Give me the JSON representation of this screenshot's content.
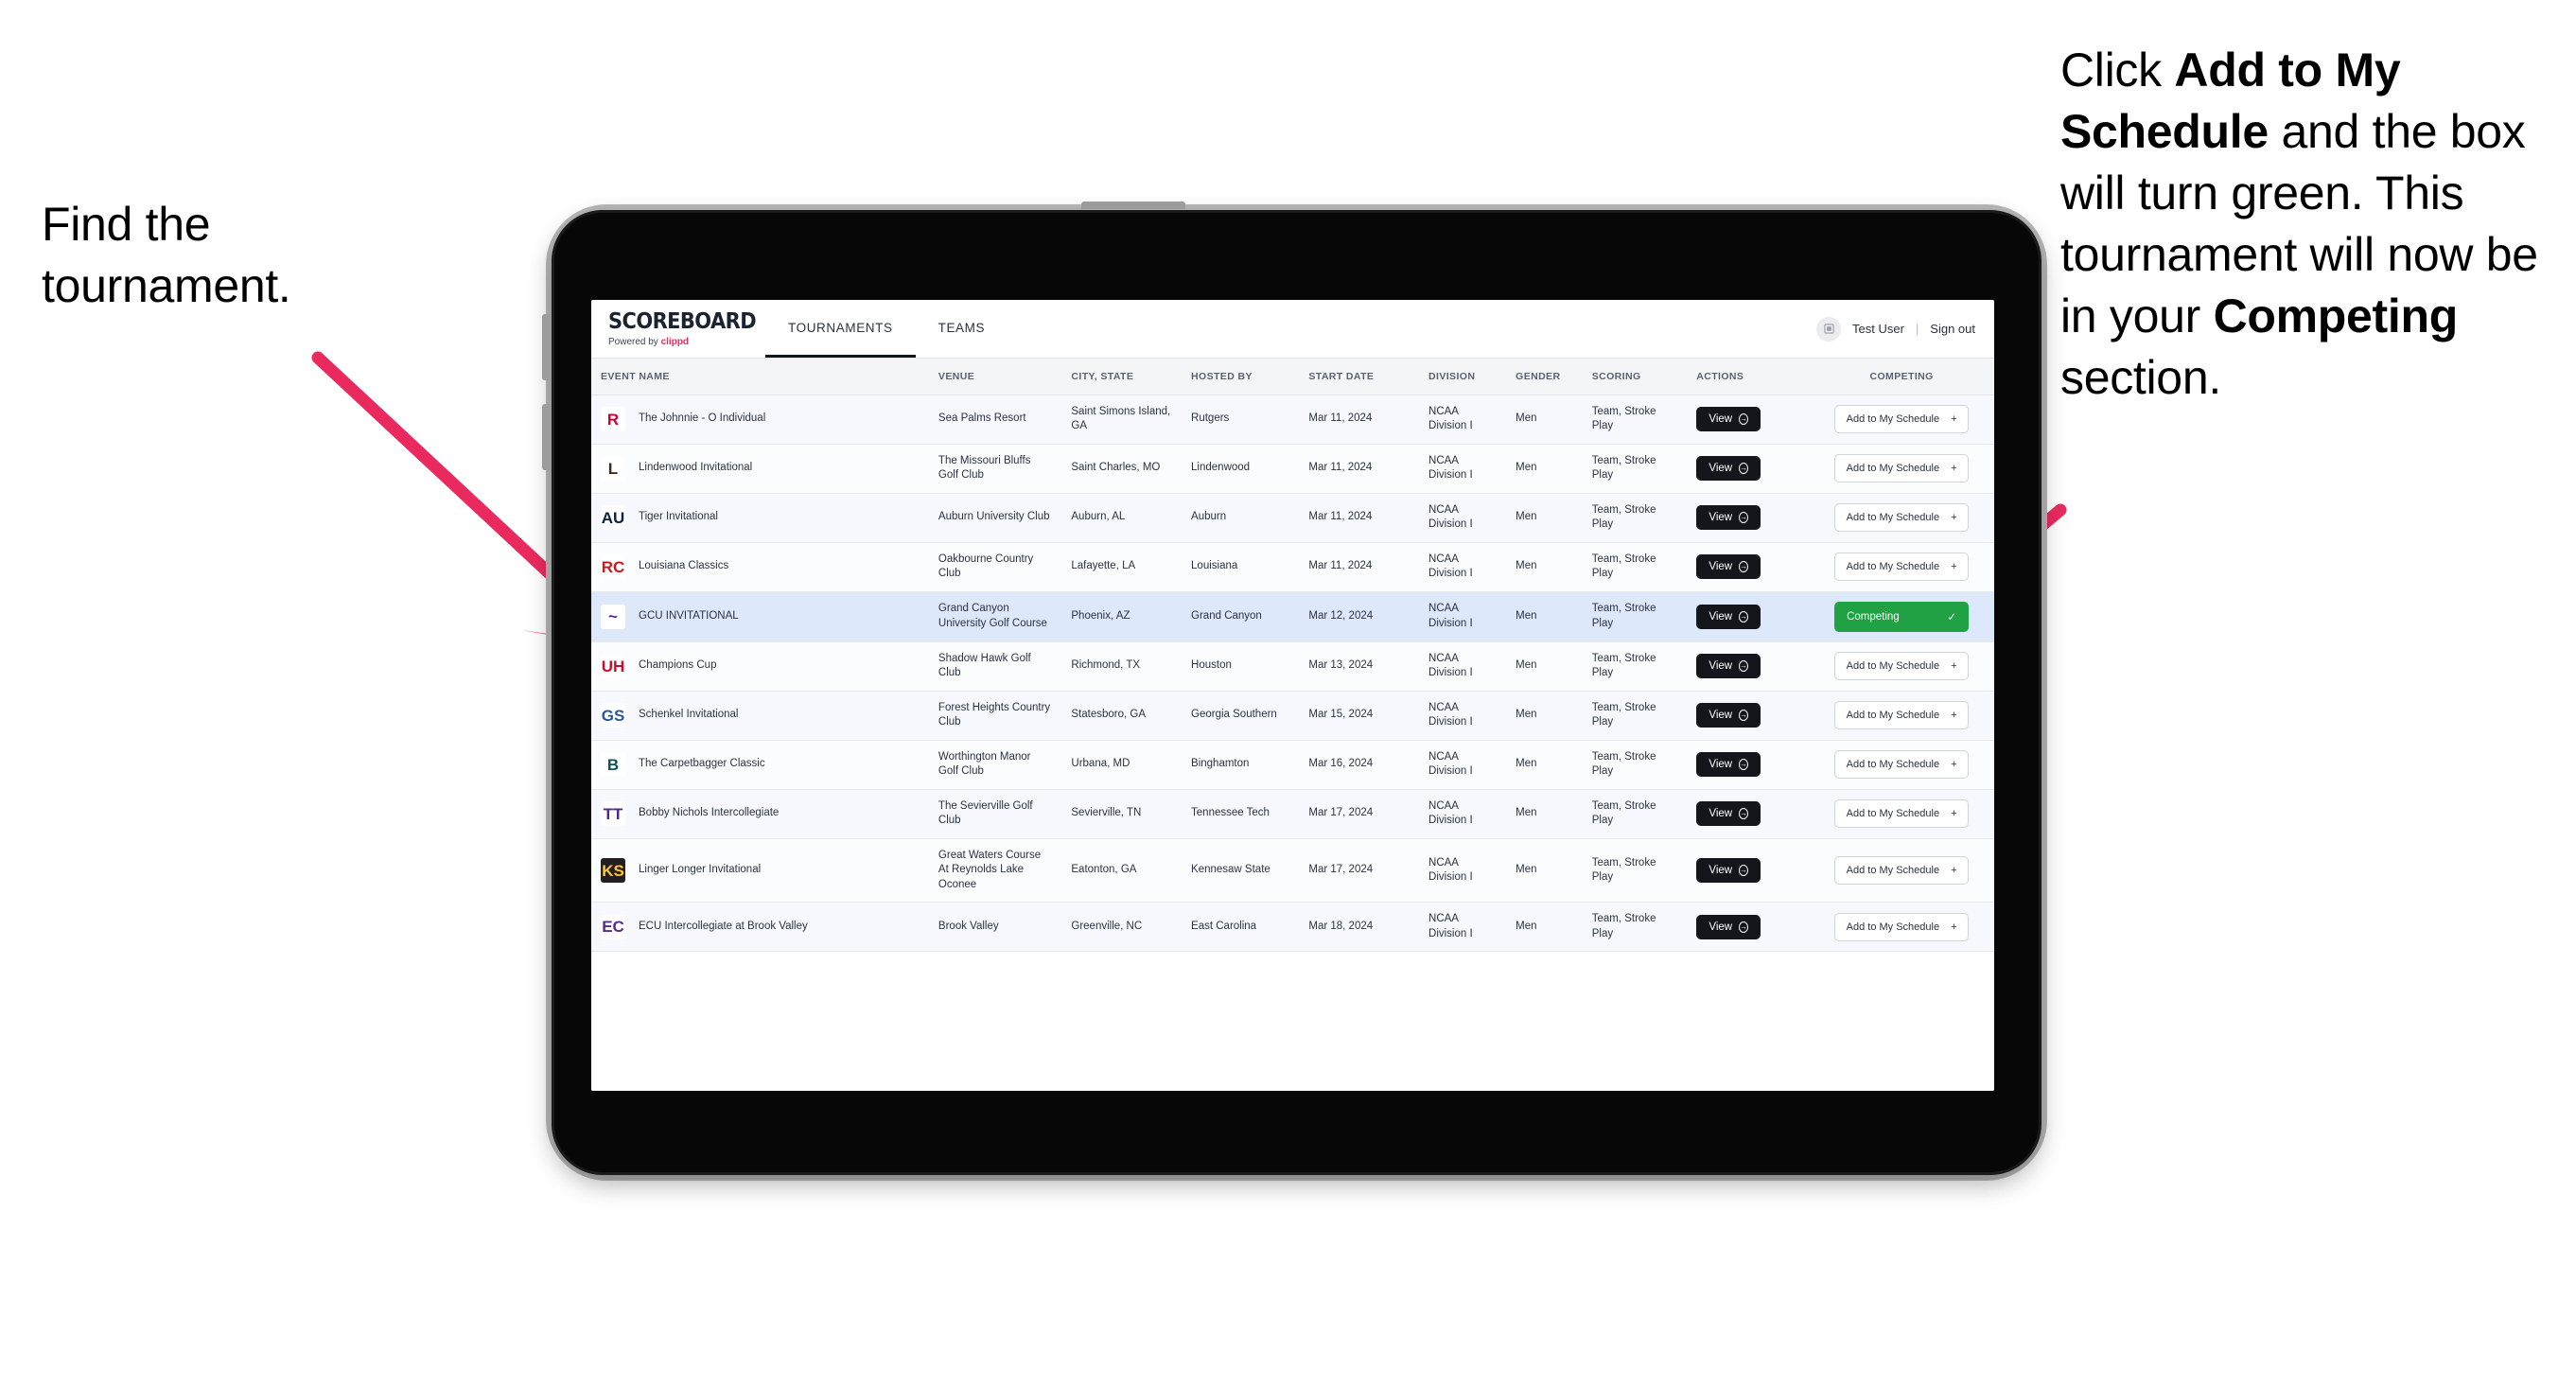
{
  "annotations": {
    "left": {
      "text": "Find the tournament."
    },
    "right": {
      "line1_pre": "Click ",
      "line1_bold": "Add to My Schedule",
      "line1_post": " and the box will turn green. This tournament will now be in your ",
      "line2_bold": "Competing",
      "line2_post": " section."
    },
    "arrow_color": "#ea2a5f"
  },
  "app": {
    "brand": {
      "title": "SCOREBOARD",
      "powered_prefix": "Powered by ",
      "powered_brand": "clippd"
    },
    "tabs": [
      {
        "label": "TOURNAMENTS",
        "active": true
      },
      {
        "label": "TEAMS",
        "active": false
      }
    ],
    "header_right": {
      "avatar_icon": "user-avatar-icon",
      "user_name": "Test User",
      "separator": "|",
      "sign_out": "Sign out"
    }
  },
  "table": {
    "columns": [
      "EVENT NAME",
      "VENUE",
      "CITY, STATE",
      "HOSTED BY",
      "START DATE",
      "DIVISION",
      "GENDER",
      "SCORING",
      "ACTIONS",
      "COMPETING"
    ],
    "view_label": "View",
    "add_label": "Add to My Schedule",
    "add_icon": "plus-icon",
    "competing_label": "Competing",
    "competing_icon": "check-icon",
    "rows": [
      {
        "logo_text": "R",
        "logo_color": "#cc0033",
        "logo_bg": "#ffffff",
        "event": "The Johnnie - O Individual",
        "venue": "Sea Palms Resort",
        "city": "Saint Simons Island, GA",
        "host": "Rutgers",
        "date": "Mar 11, 2024",
        "division": "NCAA Division I",
        "gender": "Men",
        "scoring": "Team, Stroke Play",
        "competing": false
      },
      {
        "logo_text": "L",
        "logo_color": "#3d2b1f",
        "logo_bg": "#ffffff",
        "event": "Lindenwood Invitational",
        "venue": "The Missouri Bluffs Golf Club",
        "city": "Saint Charles, MO",
        "host": "Lindenwood",
        "date": "Mar 11, 2024",
        "division": "NCAA Division I",
        "gender": "Men",
        "scoring": "Team, Stroke Play",
        "competing": false
      },
      {
        "logo_text": "AU",
        "logo_color": "#0c2340",
        "logo_bg": "#ffffff",
        "event": "Tiger Invitational",
        "venue": "Auburn University Club",
        "city": "Auburn, AL",
        "host": "Auburn",
        "date": "Mar 11, 2024",
        "division": "NCAA Division I",
        "gender": "Men",
        "scoring": "Team, Stroke Play",
        "competing": false
      },
      {
        "logo_text": "RC",
        "logo_color": "#ce181e",
        "logo_bg": "#ffffff",
        "event": "Louisiana Classics",
        "venue": "Oakbourne Country Club",
        "city": "Lafayette, LA",
        "host": "Louisiana",
        "date": "Mar 11, 2024",
        "division": "NCAA Division I",
        "gender": "Men",
        "scoring": "Team, Stroke Play",
        "competing": false
      },
      {
        "logo_text": "~",
        "logo_color": "#522398",
        "logo_bg": "#ffffff",
        "event": "GCU INVITATIONAL",
        "venue": "Grand Canyon University Golf Course",
        "city": "Phoenix, AZ",
        "host": "Grand Canyon",
        "date": "Mar 12, 2024",
        "division": "NCAA Division I",
        "gender": "Men",
        "scoring": "Team, Stroke Play",
        "competing": true
      },
      {
        "logo_text": "UH",
        "logo_color": "#c8102e",
        "logo_bg": "#ffffff",
        "event": "Champions Cup",
        "venue": "Shadow Hawk Golf Club",
        "city": "Richmond, TX",
        "host": "Houston",
        "date": "Mar 13, 2024",
        "division": "NCAA Division I",
        "gender": "Men",
        "scoring": "Team, Stroke Play",
        "competing": false
      },
      {
        "logo_text": "GS",
        "logo_color": "#2c5697",
        "logo_bg": "#ffffff",
        "event": "Schenkel Invitational",
        "venue": "Forest Heights Country Club",
        "city": "Statesboro, GA",
        "host": "Georgia Southern",
        "date": "Mar 15, 2024",
        "division": "NCAA Division I",
        "gender": "Men",
        "scoring": "Team, Stroke Play",
        "competing": false
      },
      {
        "logo_text": "B",
        "logo_color": "#0d5257",
        "logo_bg": "#ffffff",
        "event": "The Carpetbagger Classic",
        "venue": "Worthington Manor Golf Club",
        "city": "Urbana, MD",
        "host": "Binghamton",
        "date": "Mar 16, 2024",
        "division": "NCAA Division I",
        "gender": "Men",
        "scoring": "Team, Stroke Play",
        "competing": false
      },
      {
        "logo_text": "TT",
        "logo_color": "#4e2a84",
        "logo_bg": "#ffffff",
        "event": "Bobby Nichols Intercollegiate",
        "venue": "The Sevierville Golf Club",
        "city": "Sevierville, TN",
        "host": "Tennessee Tech",
        "date": "Mar 17, 2024",
        "division": "NCAA Division I",
        "gender": "Men",
        "scoring": "Team, Stroke Play",
        "competing": false
      },
      {
        "logo_text": "KS",
        "logo_color": "#ffc629",
        "logo_bg": "#231f20",
        "event": "Linger Longer Invitational",
        "venue": "Great Waters Course At Reynolds Lake Oconee",
        "city": "Eatonton, GA",
        "host": "Kennesaw State",
        "date": "Mar 17, 2024",
        "division": "NCAA Division I",
        "gender": "Men",
        "scoring": "Team, Stroke Play",
        "competing": false
      },
      {
        "logo_text": "EC",
        "logo_color": "#592a8a",
        "logo_bg": "#ffffff",
        "event": "ECU Intercollegiate at Brook Valley",
        "venue": "Brook Valley",
        "city": "Greenville, NC",
        "host": "East Carolina",
        "date": "Mar 18, 2024",
        "division": "NCAA Division I",
        "gender": "Men",
        "scoring": "Team, Stroke Play",
        "competing": false
      }
    ]
  }
}
